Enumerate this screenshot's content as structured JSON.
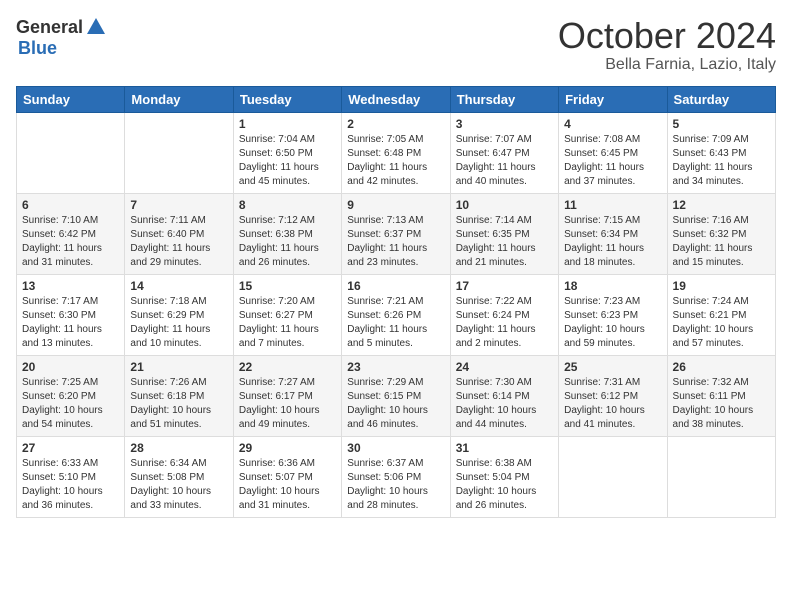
{
  "logo": {
    "general": "General",
    "blue": "Blue"
  },
  "title": "October 2024",
  "location": "Bella Farnia, Lazio, Italy",
  "days_header": [
    "Sunday",
    "Monday",
    "Tuesday",
    "Wednesday",
    "Thursday",
    "Friday",
    "Saturday"
  ],
  "weeks": [
    [
      {
        "day": "",
        "info": ""
      },
      {
        "day": "",
        "info": ""
      },
      {
        "day": "1",
        "info": "Sunrise: 7:04 AM\nSunset: 6:50 PM\nDaylight: 11 hours and 45 minutes."
      },
      {
        "day": "2",
        "info": "Sunrise: 7:05 AM\nSunset: 6:48 PM\nDaylight: 11 hours and 42 minutes."
      },
      {
        "day": "3",
        "info": "Sunrise: 7:07 AM\nSunset: 6:47 PM\nDaylight: 11 hours and 40 minutes."
      },
      {
        "day": "4",
        "info": "Sunrise: 7:08 AM\nSunset: 6:45 PM\nDaylight: 11 hours and 37 minutes."
      },
      {
        "day": "5",
        "info": "Sunrise: 7:09 AM\nSunset: 6:43 PM\nDaylight: 11 hours and 34 minutes."
      }
    ],
    [
      {
        "day": "6",
        "info": "Sunrise: 7:10 AM\nSunset: 6:42 PM\nDaylight: 11 hours and 31 minutes."
      },
      {
        "day": "7",
        "info": "Sunrise: 7:11 AM\nSunset: 6:40 PM\nDaylight: 11 hours and 29 minutes."
      },
      {
        "day": "8",
        "info": "Sunrise: 7:12 AM\nSunset: 6:38 PM\nDaylight: 11 hours and 26 minutes."
      },
      {
        "day": "9",
        "info": "Sunrise: 7:13 AM\nSunset: 6:37 PM\nDaylight: 11 hours and 23 minutes."
      },
      {
        "day": "10",
        "info": "Sunrise: 7:14 AM\nSunset: 6:35 PM\nDaylight: 11 hours and 21 minutes."
      },
      {
        "day": "11",
        "info": "Sunrise: 7:15 AM\nSunset: 6:34 PM\nDaylight: 11 hours and 18 minutes."
      },
      {
        "day": "12",
        "info": "Sunrise: 7:16 AM\nSunset: 6:32 PM\nDaylight: 11 hours and 15 minutes."
      }
    ],
    [
      {
        "day": "13",
        "info": "Sunrise: 7:17 AM\nSunset: 6:30 PM\nDaylight: 11 hours and 13 minutes."
      },
      {
        "day": "14",
        "info": "Sunrise: 7:18 AM\nSunset: 6:29 PM\nDaylight: 11 hours and 10 minutes."
      },
      {
        "day": "15",
        "info": "Sunrise: 7:20 AM\nSunset: 6:27 PM\nDaylight: 11 hours and 7 minutes."
      },
      {
        "day": "16",
        "info": "Sunrise: 7:21 AM\nSunset: 6:26 PM\nDaylight: 11 hours and 5 minutes."
      },
      {
        "day": "17",
        "info": "Sunrise: 7:22 AM\nSunset: 6:24 PM\nDaylight: 11 hours and 2 minutes."
      },
      {
        "day": "18",
        "info": "Sunrise: 7:23 AM\nSunset: 6:23 PM\nDaylight: 10 hours and 59 minutes."
      },
      {
        "day": "19",
        "info": "Sunrise: 7:24 AM\nSunset: 6:21 PM\nDaylight: 10 hours and 57 minutes."
      }
    ],
    [
      {
        "day": "20",
        "info": "Sunrise: 7:25 AM\nSunset: 6:20 PM\nDaylight: 10 hours and 54 minutes."
      },
      {
        "day": "21",
        "info": "Sunrise: 7:26 AM\nSunset: 6:18 PM\nDaylight: 10 hours and 51 minutes."
      },
      {
        "day": "22",
        "info": "Sunrise: 7:27 AM\nSunset: 6:17 PM\nDaylight: 10 hours and 49 minutes."
      },
      {
        "day": "23",
        "info": "Sunrise: 7:29 AM\nSunset: 6:15 PM\nDaylight: 10 hours and 46 minutes."
      },
      {
        "day": "24",
        "info": "Sunrise: 7:30 AM\nSunset: 6:14 PM\nDaylight: 10 hours and 44 minutes."
      },
      {
        "day": "25",
        "info": "Sunrise: 7:31 AM\nSunset: 6:12 PM\nDaylight: 10 hours and 41 minutes."
      },
      {
        "day": "26",
        "info": "Sunrise: 7:32 AM\nSunset: 6:11 PM\nDaylight: 10 hours and 38 minutes."
      }
    ],
    [
      {
        "day": "27",
        "info": "Sunrise: 6:33 AM\nSunset: 5:10 PM\nDaylight: 10 hours and 36 minutes."
      },
      {
        "day": "28",
        "info": "Sunrise: 6:34 AM\nSunset: 5:08 PM\nDaylight: 10 hours and 33 minutes."
      },
      {
        "day": "29",
        "info": "Sunrise: 6:36 AM\nSunset: 5:07 PM\nDaylight: 10 hours and 31 minutes."
      },
      {
        "day": "30",
        "info": "Sunrise: 6:37 AM\nSunset: 5:06 PM\nDaylight: 10 hours and 28 minutes."
      },
      {
        "day": "31",
        "info": "Sunrise: 6:38 AM\nSunset: 5:04 PM\nDaylight: 10 hours and 26 minutes."
      },
      {
        "day": "",
        "info": ""
      },
      {
        "day": "",
        "info": ""
      }
    ]
  ]
}
